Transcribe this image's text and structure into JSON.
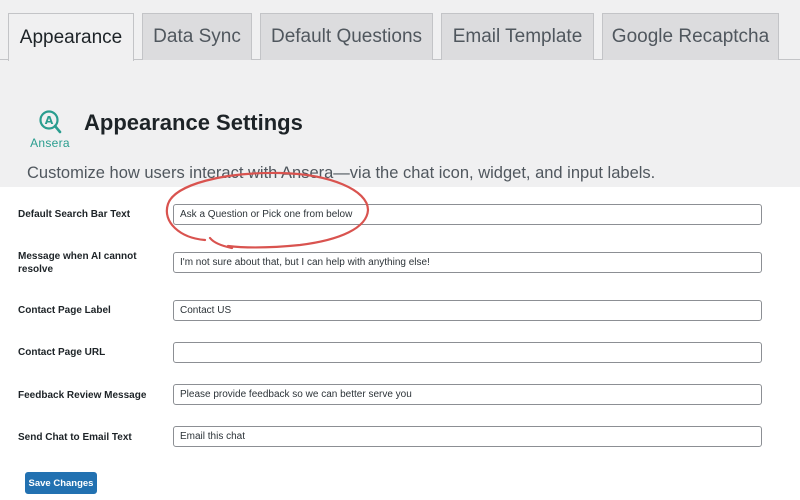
{
  "tabs": [
    {
      "label": "Appearance",
      "active": true
    },
    {
      "label": "Data Sync",
      "active": false
    },
    {
      "label": "Default Questions",
      "active": false
    },
    {
      "label": "Email Template",
      "active": false
    },
    {
      "label": "Google Recaptcha",
      "active": false
    }
  ],
  "brand": {
    "name": "Ansera",
    "icon": "magnifier-a-icon",
    "color": "#2a9d8f"
  },
  "header": {
    "title": "Appearance Settings",
    "subtitle": "Customize how users interact with Ansera—via the chat icon, widget, and input labels."
  },
  "form": {
    "fields": [
      {
        "label": "Default Search Bar Text",
        "value": "Ask a Question or Pick one from below"
      },
      {
        "label": "Message when AI cannot resolve",
        "value": "I'm not sure about that, but I can help with anything else!"
      },
      {
        "label": "Contact Page Label",
        "value": "Contact US"
      },
      {
        "label": "Contact Page URL",
        "value": ""
      },
      {
        "label": "Feedback Review Message",
        "value": "Please provide feedback so we can better serve you"
      },
      {
        "label": "Send Chat to Email Text",
        "value": "Email this chat"
      }
    ],
    "save_label": "Save Changes"
  },
  "colors": {
    "primary": "#2271b1",
    "annotation": "#d9534f"
  }
}
